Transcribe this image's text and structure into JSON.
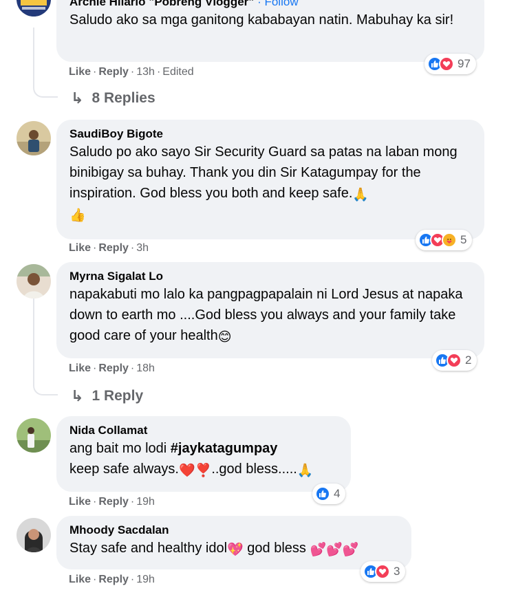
{
  "colors": {
    "bubble": "#f0f2f5",
    "meta_text": "#65676b",
    "link_blue": "#1877f2",
    "like_blue": "#1877f2",
    "love_red": "#f33e58",
    "care_yellow": "#f7b125"
  },
  "actions": {
    "like": "Like",
    "reply": "Reply",
    "separator": "·"
  },
  "comments": [
    {
      "author": "Archie Hilario \"Pobreng Vlogger\"",
      "follow": "Follow",
      "text": "Saludo ako sa mga ganitong kababayan natin. Mabuhay ka sir!",
      "time": "13h",
      "edited": "Edited",
      "reactions": {
        "icons": [
          "like-icon",
          "love-icon"
        ],
        "count": "97"
      },
      "replies": "8 Replies"
    },
    {
      "author": "SaudiBoy Bigote",
      "text": "Saludo po ako sayo Sir Security Guard sa patas na laban mong binibigay sa buhay. Thank you din Sir Katagumpay for the inspiration. God bless you both and keep safe.",
      "emoji_end": "🙏",
      "emoji_line2": "👍",
      "time": "3h",
      "reactions": {
        "icons": [
          "like-icon",
          "love-icon",
          "care-icon"
        ],
        "count": "5"
      }
    },
    {
      "author": "Myrna Sigalat Lo",
      "text": "napakabuti mo lalo ka pangpagpapalain ni Lord Jesus at napaka down to earth mo ....God bless you always and your family take good care of your health",
      "emoji_end": "😊",
      "time": "18h",
      "reactions": {
        "icons": [
          "like-icon",
          "love-icon"
        ],
        "count": "2"
      },
      "replies": "1 Reply"
    },
    {
      "author": "Nida Collamat",
      "text_before": "ang bait mo lodi ",
      "hashtag": "#jaykatagumpay",
      "text_line2": "keep safe always.",
      "emoji_hearts": "❤️❣️",
      "text_line2_end": "..god bless.....",
      "emoji_end": "🙏",
      "time": "19h",
      "reactions": {
        "icons": [
          "like-icon"
        ],
        "count": "4"
      }
    },
    {
      "author": "Mhoody Sacdalan",
      "text": "Stay safe and healthy idol",
      "emoji_mid": "💖",
      "text_after": " god bless ",
      "emoji_end": "💕💕💕",
      "time": "19h",
      "reactions": {
        "icons": [
          "like-icon",
          "love-icon"
        ],
        "count": "3"
      }
    }
  ]
}
